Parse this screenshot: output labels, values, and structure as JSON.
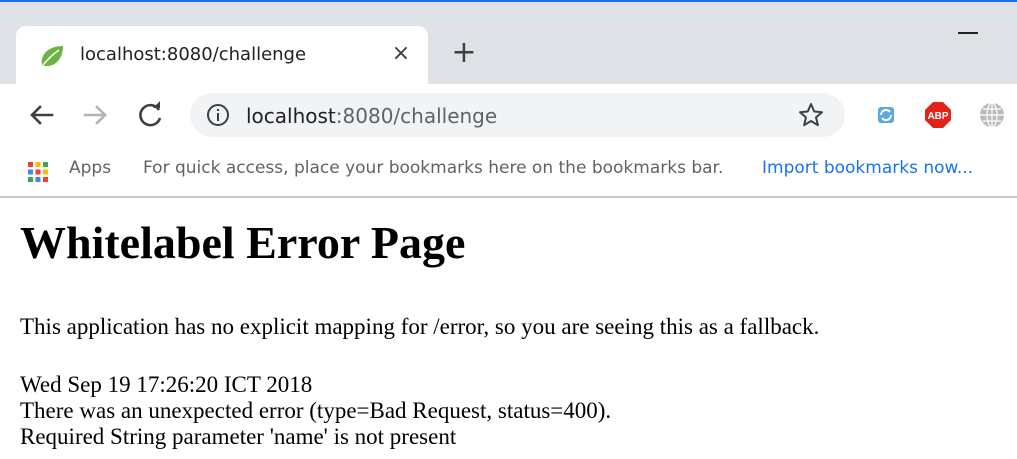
{
  "tab": {
    "title": "localhost:8080/challenge",
    "close_glyph": "×",
    "favicon": "spring-leaf-icon"
  },
  "new_tab_glyph": "+",
  "toolbar": {
    "url_host": "localhost",
    "url_rest": ":8080/challenge",
    "back": "arrow-left-icon",
    "forward": "arrow-right-icon",
    "reload": "reload-icon"
  },
  "bookmarks": {
    "apps_label": "Apps",
    "hint": "For quick access, place your bookmarks here on the bookmarks bar.",
    "import_link": "Import bookmarks now..."
  },
  "extensions": [
    "sync-extension-icon",
    "adblock-plus-icon",
    "globe-extension-icon"
  ],
  "adblock_label": "ABP",
  "page": {
    "title": "Whitelabel Error Page",
    "message": "This application has no explicit mapping for /error, so you are seeing this as a fallback.",
    "timestamp": "Wed Sep 19 17:26:20 ICT 2018",
    "error_line": "There was an unexpected error (type=Bad Request, status=400).",
    "detail_line": "Required String parameter 'name' is not present"
  },
  "colors": {
    "accent": "#1a73e8",
    "tabbar_bg": "#dee1e6",
    "omnibox_bg": "#f1f3f4",
    "adblock_red": "#e2231a",
    "spring_green": "#6db33f"
  }
}
